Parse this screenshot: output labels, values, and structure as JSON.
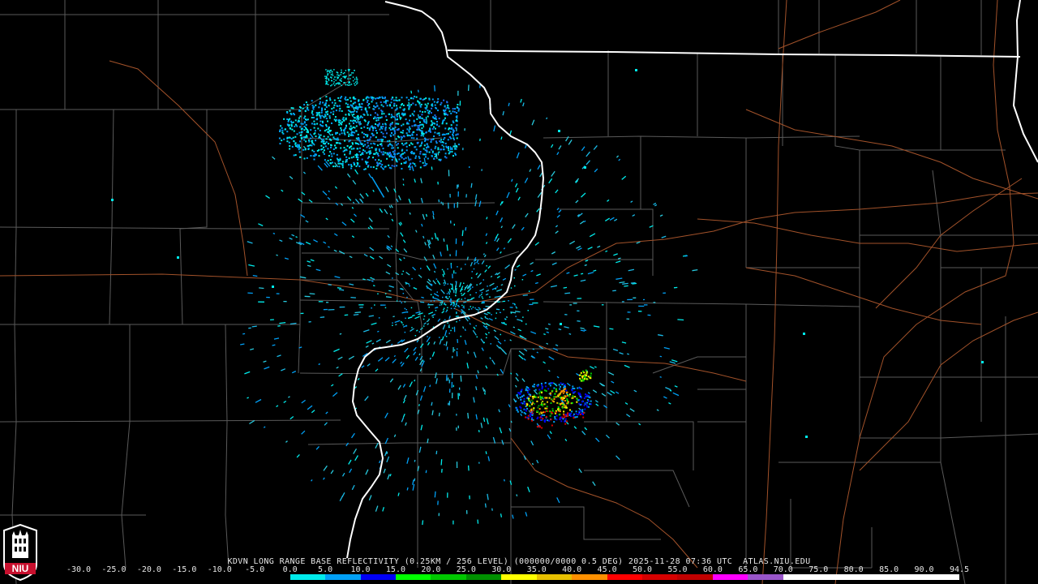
{
  "product_line": "KDVN LONG RANGE BASE REFLECTIVITY (0.25KM / 256 LEVEL) (000000/0000 0.5 DEG) 2025-11-28 07:36 UTC  ATLAS.NIU.EDU",
  "logo_text": "NIU",
  "legend": {
    "ticks": [
      "-30.0",
      "-25.0",
      "-20.0",
      "-15.0",
      "-10.0",
      "-5.0",
      "0.0",
      "5.0",
      "10.0",
      "15.0",
      "20.0",
      "25.0",
      "30.0",
      "35.0",
      "40.0",
      "45.0",
      "50.0",
      "55.0",
      "60.0",
      "65.0",
      "70.0",
      "75.0",
      "80.0",
      "85.0",
      "90.0",
      "94.5"
    ],
    "colors": [
      "#000000",
      "#000000",
      "#000000",
      "#000000",
      "#000000",
      "#000000",
      "#00ecec",
      "#01a0f6",
      "#0000f6",
      "#00ff00",
      "#00c800",
      "#009000",
      "#ffff00",
      "#e7c000",
      "#ff9000",
      "#ff0000",
      "#d60000",
      "#c00000",
      "#ff00ff",
      "#9955c9",
      "#ffffff",
      "#ffffff",
      "#ffffff",
      "#ffffff",
      "#ffffff"
    ]
  },
  "colors": {
    "background": "#000000",
    "county_lines": "#5a5a5a",
    "state_lines": "#ffffff",
    "highways": "#a2522a"
  }
}
